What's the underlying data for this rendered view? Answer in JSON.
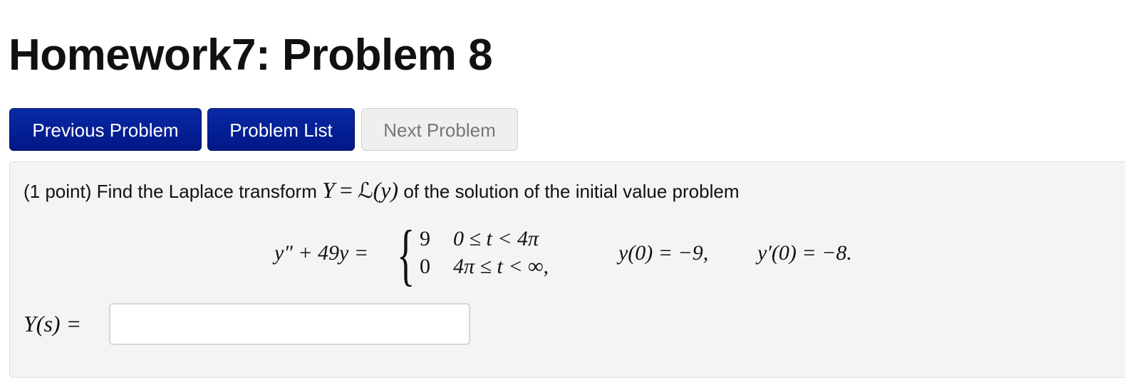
{
  "page": {
    "title": "Homework7: Problem 8"
  },
  "nav": {
    "previous_label": "Previous Problem",
    "list_label": "Problem List",
    "next_label": "Next Problem"
  },
  "problem": {
    "intro_prefix": "(1 point) Find the Laplace transform",
    "transform_lhs": "Y",
    "transform_eq": "=",
    "transform_op": "ℒ",
    "transform_arg": "(y)",
    "intro_suffix": "of the solution of the initial value problem",
    "equation": {
      "lhs": "y″ + 49y =",
      "cases": [
        {
          "value": "9",
          "condition": "0 ≤ t < 4π"
        },
        {
          "value": "0",
          "condition": "4π ≤ t < ∞,"
        }
      ],
      "initial_condition_1": "y(0) = −9,",
      "initial_condition_2": "y′(0) = −8."
    },
    "answer": {
      "label": "Y(s) =",
      "value": "",
      "placeholder": ""
    }
  },
  "colors": {
    "primary_button": "#041f98",
    "disabled_button": "#efefef",
    "problem_background": "#f4f4f4"
  }
}
